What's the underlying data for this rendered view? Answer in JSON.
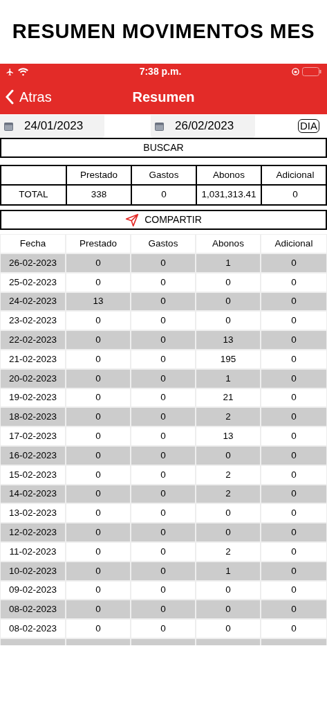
{
  "page_title": "RESUMEN MOVIMENTOS MES",
  "status_bar": {
    "time": "7:38 p.m."
  },
  "nav": {
    "back": "Atras",
    "title": "Resumen"
  },
  "filters": {
    "from": "24/01/2023",
    "to": "26/02/2023",
    "mode_button": "DIA"
  },
  "search_button": "BUSCAR",
  "summary": {
    "columns": [
      "",
      "Prestado",
      "Gastos",
      "Abonos",
      "Adicional"
    ],
    "row": [
      "TOTAL",
      "338",
      "0",
      "1,031,313.41",
      "0"
    ]
  },
  "share_button": "COMPARTIR",
  "table": {
    "columns": [
      "Fecha",
      "Prestado",
      "Gastos",
      "Abonos",
      "Adicional"
    ],
    "rows": [
      [
        "26-02-2023",
        "0",
        "0",
        "1",
        "0"
      ],
      [
        "25-02-2023",
        "0",
        "0",
        "0",
        "0"
      ],
      [
        "24-02-2023",
        "13",
        "0",
        "0",
        "0"
      ],
      [
        "23-02-2023",
        "0",
        "0",
        "0",
        "0"
      ],
      [
        "22-02-2023",
        "0",
        "0",
        "13",
        "0"
      ],
      [
        "21-02-2023",
        "0",
        "0",
        "195",
        "0"
      ],
      [
        "20-02-2023",
        "0",
        "0",
        "1",
        "0"
      ],
      [
        "19-02-2023",
        "0",
        "0",
        "21",
        "0"
      ],
      [
        "18-02-2023",
        "0",
        "0",
        "2",
        "0"
      ],
      [
        "17-02-2023",
        "0",
        "0",
        "13",
        "0"
      ],
      [
        "16-02-2023",
        "0",
        "0",
        "0",
        "0"
      ],
      [
        "15-02-2023",
        "0",
        "0",
        "2",
        "0"
      ],
      [
        "14-02-2023",
        "0",
        "0",
        "2",
        "0"
      ],
      [
        "13-02-2023",
        "0",
        "0",
        "0",
        "0"
      ],
      [
        "12-02-2023",
        "0",
        "0",
        "0",
        "0"
      ],
      [
        "11-02-2023",
        "0",
        "0",
        "2",
        "0"
      ],
      [
        "10-02-2023",
        "0",
        "0",
        "1",
        "0"
      ],
      [
        "09-02-2023",
        "0",
        "0",
        "0",
        "0"
      ],
      [
        "08-02-2023",
        "0",
        "0",
        "0",
        "0"
      ],
      [
        "08-02-2023",
        "0",
        "0",
        "0",
        "0"
      ]
    ]
  }
}
